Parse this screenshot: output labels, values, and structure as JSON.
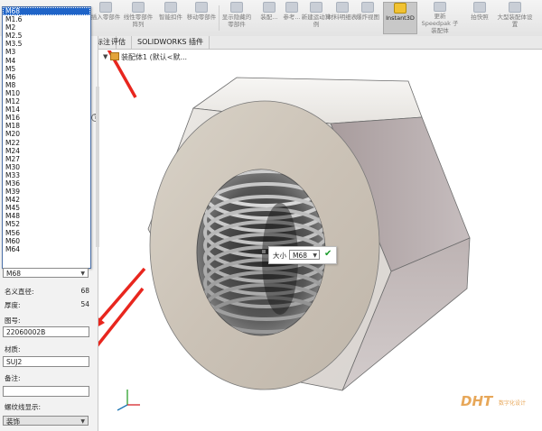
{
  "ribbon": {
    "buttons": [
      {
        "label": "插入零部件"
      },
      {
        "label": "线性零部件阵列"
      },
      {
        "label": "智能扣件"
      },
      {
        "label": "移动零部件"
      },
      {
        "label": "显示隐藏的零部件"
      },
      {
        "label": "装配..."
      },
      {
        "label": "参考..."
      },
      {
        "label": "新建运动算例"
      },
      {
        "label": "材料明细表"
      },
      {
        "label": "爆炸视图"
      },
      {
        "label": "Instant3D"
      },
      {
        "label": "更新 Speedpak 子装配体"
      },
      {
        "label": "拍快照"
      },
      {
        "label": "大型装配体设置"
      }
    ]
  },
  "tabs": [
    {
      "label": "标注"
    },
    {
      "label": "评估"
    },
    {
      "label": "SOLIDWORKS 插件"
    }
  ],
  "breadcrumb": {
    "text": "装配体1 (默认<默..."
  },
  "panel": {
    "size_options": [
      "M68",
      "M1.6",
      "M2",
      "M2.5",
      "M3.5",
      "M3",
      "M4",
      "M5",
      "M6",
      "M8",
      "M10",
      "M12",
      "M14",
      "M16",
      "M18",
      "M20",
      "M22",
      "M24",
      "M27",
      "M30",
      "M33",
      "M36",
      "M39",
      "M42",
      "M45",
      "M48",
      "M52",
      "M56",
      "M60",
      "M64"
    ],
    "size_selected": "M68",
    "nominal_label": "名义直径:",
    "nominal_value": "68",
    "thickness_label": "厚度:",
    "thickness_value": "54",
    "part_no_label": "图号:",
    "part_no_value": "22060002B",
    "material_label": "材质:",
    "material_value": "SUJ2",
    "remark_label": "备注:",
    "remark_value": "",
    "thread_label": "螺纹线显示:",
    "thread_value": "装饰"
  },
  "popup": {
    "label": "大小",
    "value": "M68"
  },
  "watermark": {
    "text": "DHT",
    "sub": "数字化设计"
  },
  "colors": {
    "selection": "#1f64c8",
    "arrow": "#e8261e",
    "check": "#1b9b2c",
    "ribbon_active": "#c8c8c8"
  }
}
